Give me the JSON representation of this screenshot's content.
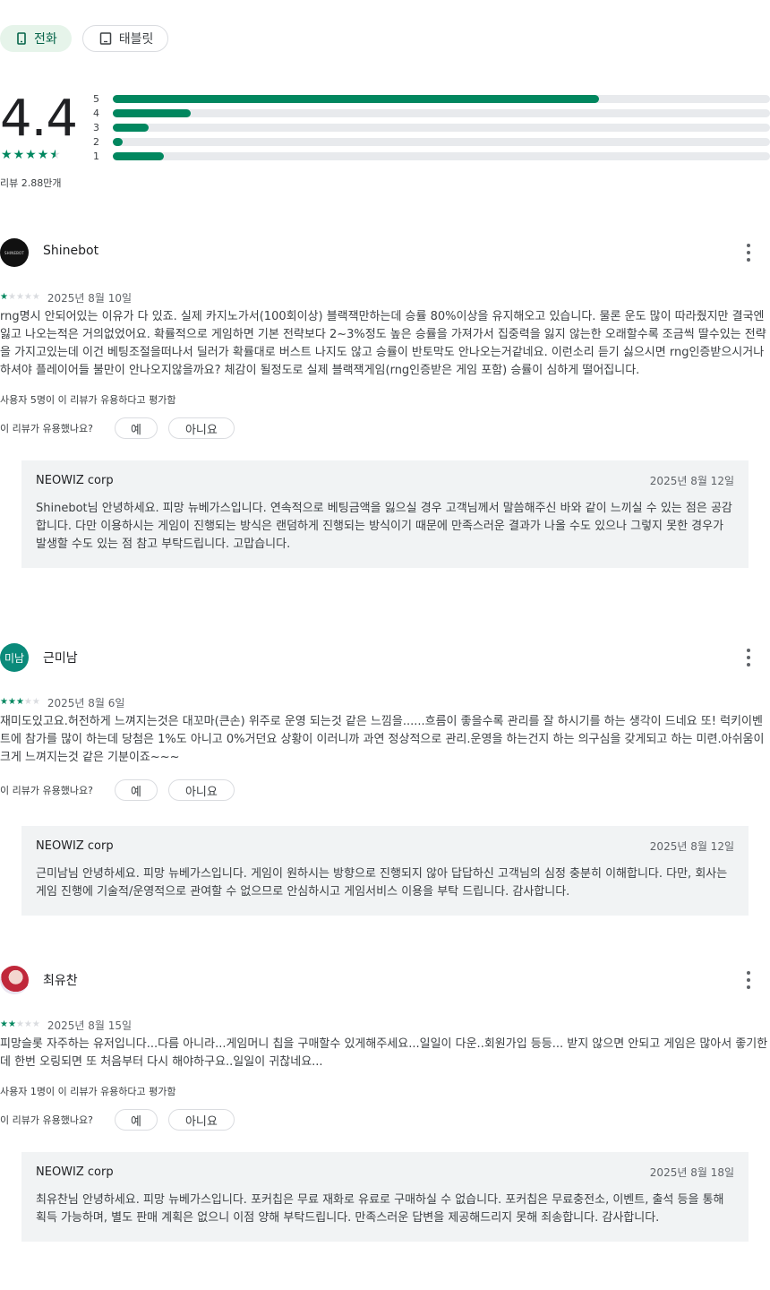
{
  "device_tabs": [
    {
      "label": "전화",
      "icon": "phone-icon",
      "active": true
    },
    {
      "label": "태블릿",
      "icon": "tablet-icon",
      "active": false
    }
  ],
  "rating": {
    "score": "4.4",
    "stars_value": 4.5,
    "review_count": "리뷰 2.88만개",
    "histogram": [
      {
        "label": "5",
        "fraction": 0.74
      },
      {
        "label": "4",
        "fraction": 0.118
      },
      {
        "label": "3",
        "fraction": 0.055
      },
      {
        "label": "2",
        "fraction": 0.015
      },
      {
        "label": "1",
        "fraction": 0.077
      }
    ]
  },
  "helpful_question": "이 리뷰가 유용했나요?",
  "yes_label": "예",
  "no_label": "아니요",
  "reviews": [
    {
      "author": "Shinebot",
      "avatar_text": "SHINEBOT",
      "stars": 1,
      "date": "2025년 8월 10일",
      "text": "rng명시 안되어있는 이유가 다 있죠. 실제 카지노가서(100회이상) 블랙잭만하는데 승률 80%이상을 유지해오고 있습니다. 물론 운도 많이 따라줬지만 결국엔 잃고 나오는적은 거의없었어요. 확률적으로 게임하면 기본 전략보다 2~3%정도 높은 승률을 가져가서 집중력을 잃지 않는한 오래할수록 조금씩 딸수있는 전략을 가지고있는데 이건 베팅조절을떠나서 딜러가 확률대로 버스트 나지도 않고 승률이 반토막도 안나오는거같네요. 이런소리 듣기 싫으시면 rng인증받으시거나 하셔야 플레이어들 불만이 안나오지않을까요? 체감이 될정도로 실제 블랙잭게임(rng인증받은 게임 포함) 승률이 심하게 떨어집니다.",
      "helpful_count": "사용자 5명이 이 리뷰가 유용하다고 평가함",
      "reply": {
        "developer": "NEOWIZ corp",
        "date": "2025년 8월 12일",
        "text": "Shinebot님 안녕하세요. 피망 뉴베가스입니다. 연속적으로 베팅금액을 잃으실 경우 고객님께서 말씀해주신 바와 같이 느끼실 수 있는 점은 공감합니다. 다만 이용하시는 게임이 진행되는 방식은 랜덤하게 진행되는 방식이기 때문에 만족스러운 결과가 나올 수도 있으나 그렇지 못한 경우가 발생할 수도 있는 점 참고 부탁드립니다. 고맙습니다."
      }
    },
    {
      "author": "근미남",
      "avatar_text": "미남",
      "stars": 3,
      "date": "2025년 8월 6일",
      "text": "재미도있고요.허전하게 느껴지는것은 대꼬마(큰손) 위주로 운영 되는것 같은 느낌을......흐름이 좋을수록 관리를 잘 하시기를 하는 생각이 드네요 또! 럭키이벤트에 참가를 많이 하는데 당첨은 1%도 아니고 0%거던요 상황이 이러니까 과연 정상적으로 관리.운영을 하는건지 하는 의구심을 갖게되고 하는 미련.아쉬움이 크게 느껴지는것 같은 기분이죠~~~",
      "helpful_count": "",
      "reply": {
        "developer": "NEOWIZ corp",
        "date": "2025년 8월 12일",
        "text": "근미남님 안녕하세요. 피망 뉴베가스입니다. 게임이 원하시는 방향으로 진행되지 않아 답답하신 고객님의 심정 충분히 이해합니다. 다만, 회사는 게임 진행에 기술적/운영적으로 관여할 수 없으므로 안심하시고 게임서비스 이용을 부탁 드립니다. 감사합니다."
      }
    },
    {
      "author": "최유찬",
      "avatar_text": "",
      "stars": 2,
      "date": "2025년 8월 15일",
      "text": "피망슬롯 자주하는 유저입니다...다름 아니라...게임머니 칩을 구매할수 있게해주세요...일일이 다운..회원가입 등등... 받지 않으면 안되고 게임은 많아서 좋기한데 한번 오링되면 또 처음부터 다시 해야하구요..일일이 귀찮네요...",
      "helpful_count": "사용자 1명이 이 리뷰가 유용하다고 평가함",
      "reply": {
        "developer": "NEOWIZ corp",
        "date": "2025년 8월 18일",
        "text": "최유찬님 안녕하세요. 피망 뉴베가스입니다. 포커칩은 무료 재화로 유료로 구매하실 수 없습니다. 포커칩은 무료충전소, 이벤트, 출석 등을 통해 획득 가능하며, 별도 판매 계획은 없으니 이점 양해 부탁드립니다. 만족스러운 답변을 제공해드리지 못해 죄송합니다. 감사합니다."
      }
    }
  ],
  "colors": {
    "accent": "#01875f",
    "chip_active_bg": "#e6f4ea",
    "reply_bg": "#f1f3f4"
  }
}
